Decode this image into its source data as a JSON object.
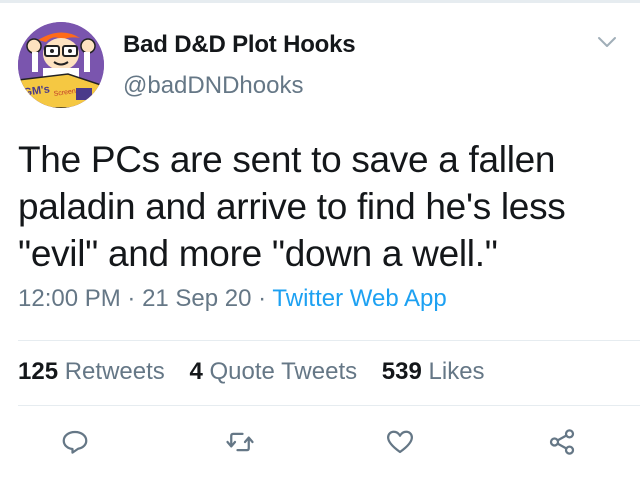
{
  "author": {
    "display_name": "Bad D&D Plot Hooks",
    "handle": "@badDNDhooks",
    "avatar_icon": "gm-screen-character-avatar",
    "avatar_text": "GM's Screen"
  },
  "tweet": {
    "text": "The PCs are sent to save a fallen paladin and arrive to find he's less \"evil\" and more \"down a well.\""
  },
  "meta": {
    "time": "12:00 PM",
    "separator": " · ",
    "date": "21 Sep 20",
    "source": "Twitter Web App"
  },
  "stats": {
    "retweets_count": "125",
    "retweets_label": "Retweets",
    "quotes_count": "4",
    "quotes_label": "Quote Tweets",
    "likes_count": "539",
    "likes_label": "Likes"
  },
  "actions": {
    "reply_icon": "reply-icon",
    "retweet_icon": "retweet-icon",
    "like_icon": "heart-icon",
    "share_icon": "share-icon"
  },
  "colors": {
    "text": "#14171a",
    "secondary": "#657786",
    "link": "#1da1f2",
    "border": "#e6ecf0"
  }
}
